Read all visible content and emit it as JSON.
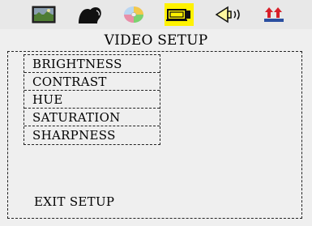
{
  "tabs": [
    {
      "icon": "landscape-picture-icon",
      "active": false
    },
    {
      "icon": "faces-language-icon",
      "active": false
    },
    {
      "icon": "colorful-disc-icon",
      "active": false
    },
    {
      "icon": "video-projector-icon",
      "active": true
    },
    {
      "icon": "speaker-audio-icon",
      "active": false
    },
    {
      "icon": "people-arrow-preference-icon",
      "active": false
    }
  ],
  "page": {
    "title": "VIDEO SETUP"
  },
  "menu": {
    "items": [
      {
        "label": "BRIGHTNESS"
      },
      {
        "label": "CONTRAST"
      },
      {
        "label": "HUE"
      },
      {
        "label": "SATURATION"
      },
      {
        "label": "SHARPNESS"
      }
    ]
  },
  "exit": {
    "label": "EXIT SETUP"
  },
  "colors": {
    "background": "#efefef",
    "active_tab": "#fff200"
  }
}
